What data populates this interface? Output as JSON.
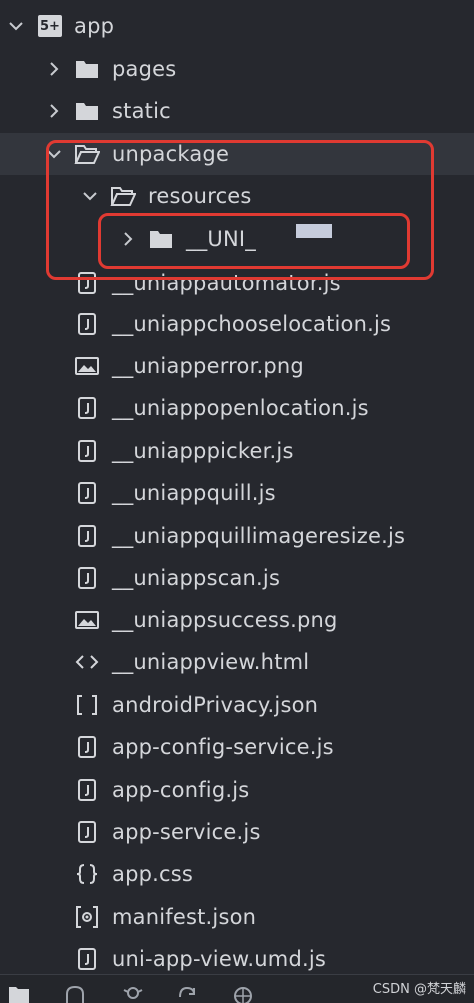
{
  "tree": {
    "root": {
      "label": "app",
      "badge": "5+"
    },
    "items": [
      {
        "label": "pages"
      },
      {
        "label": "static"
      },
      {
        "label": "unpackage"
      },
      {
        "label": "resources"
      },
      {
        "label": "__UNI_"
      },
      {
        "label": "__uniappautomator.js"
      },
      {
        "label": "__uniappchooselocation.js"
      },
      {
        "label": "__uniapperror.png"
      },
      {
        "label": "__uniappopenlocation.js"
      },
      {
        "label": "__uniapppicker.js"
      },
      {
        "label": "__uniappquill.js"
      },
      {
        "label": "__uniappquillimageresize.js"
      },
      {
        "label": "__uniappscan.js"
      },
      {
        "label": "__uniappsuccess.png"
      },
      {
        "label": "__uniappview.html"
      },
      {
        "label": "androidPrivacy.json"
      },
      {
        "label": "app-config-service.js"
      },
      {
        "label": "app-config.js"
      },
      {
        "label": "app-service.js"
      },
      {
        "label": "app.css"
      },
      {
        "label": "manifest.json"
      },
      {
        "label": "uni-app-view.umd.js"
      }
    ]
  },
  "watermark": "CSDN @梵天麟",
  "colors": {
    "background": "#26282e",
    "highlight": "#e03a32",
    "text": "#d4d6da"
  }
}
